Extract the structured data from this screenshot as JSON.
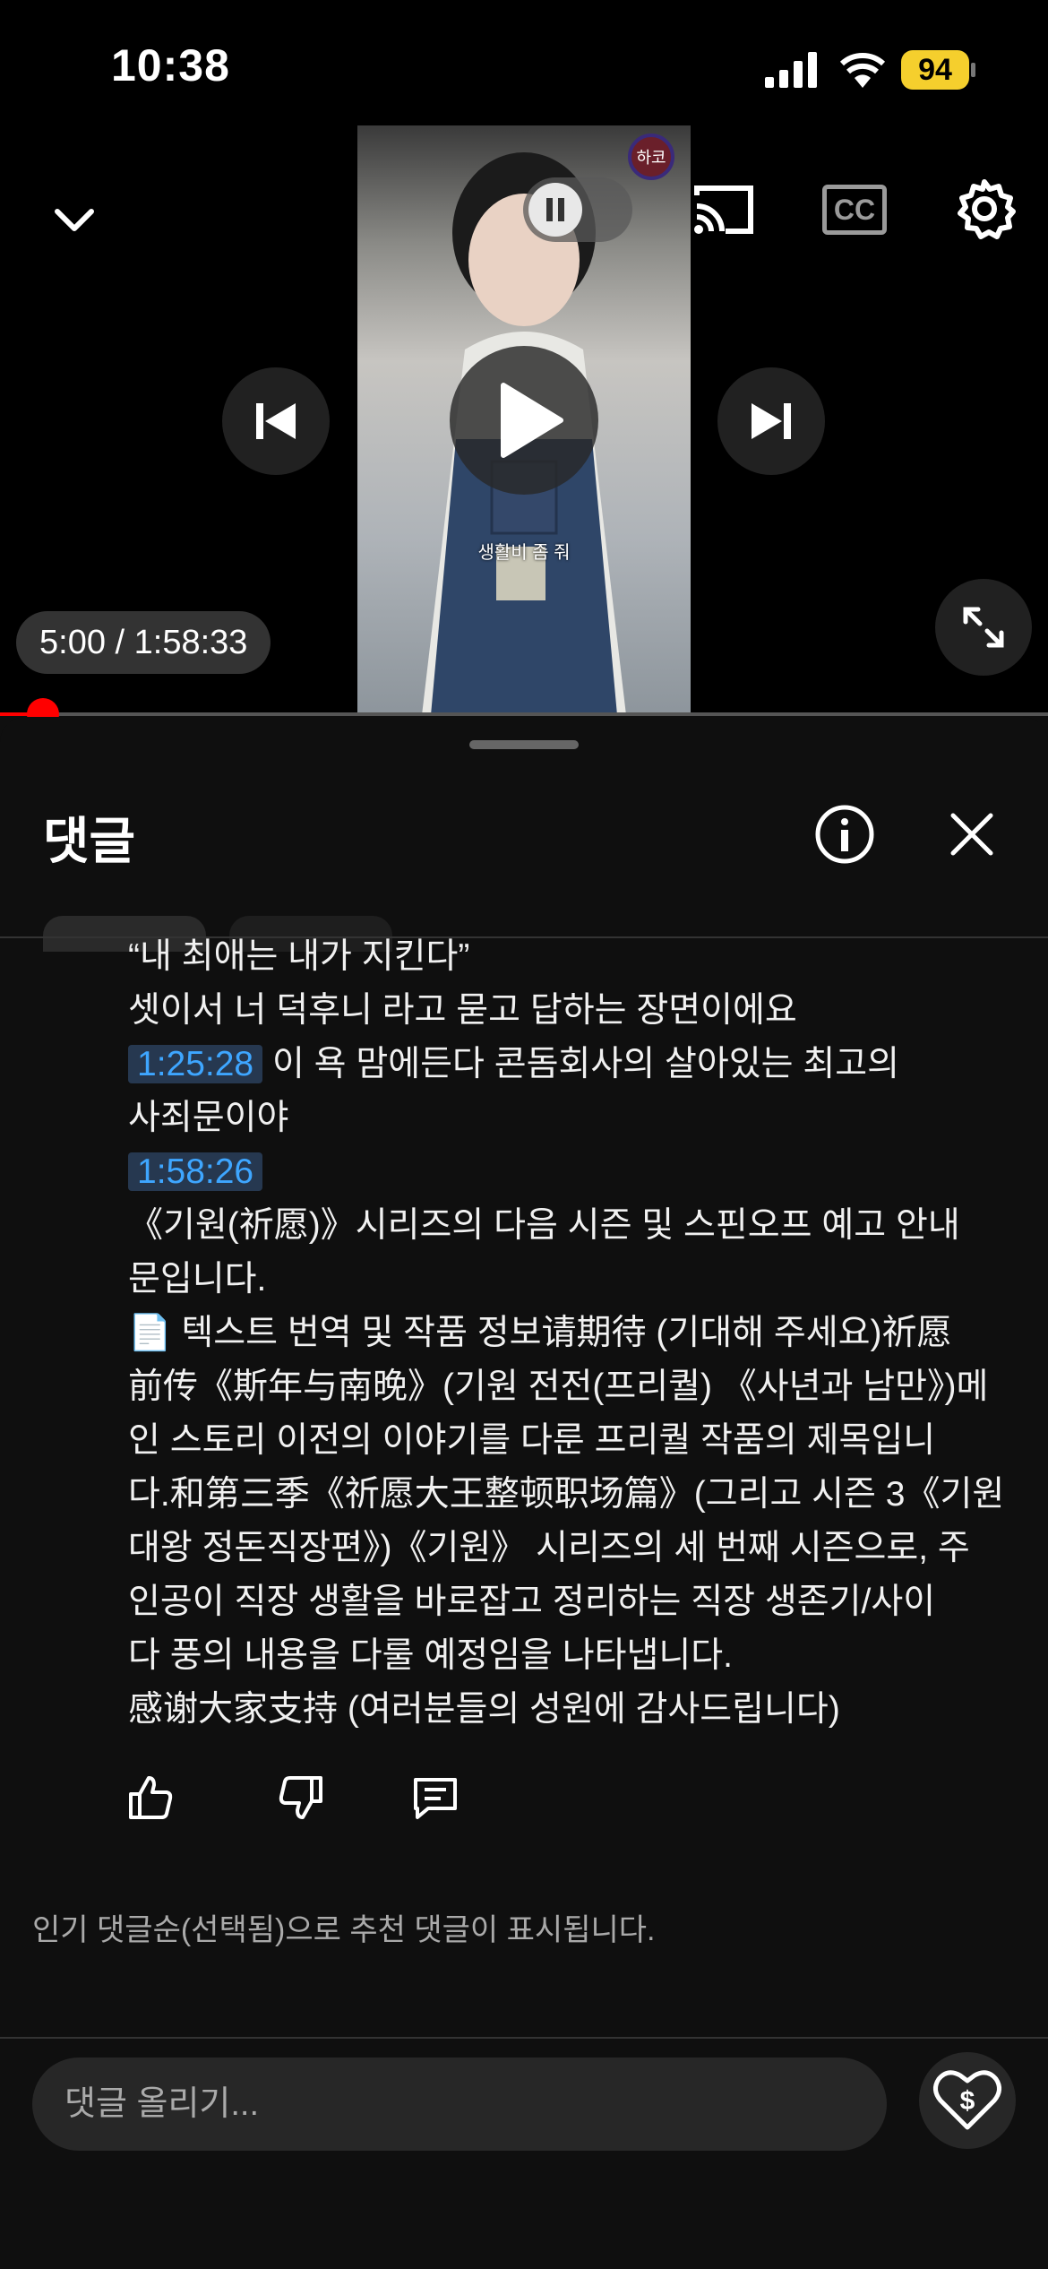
{
  "status_bar": {
    "time": "10:38",
    "battery": "94"
  },
  "video": {
    "time_display": "5:00 / 1:58:33",
    "overlay_caption": "생활비 좀 줘",
    "channel_mark": "하코",
    "progress_fraction": 0.0042
  },
  "sheet": {
    "title": "댓글"
  },
  "comment": {
    "lines": [
      {
        "text": "“내 최애는 내가 지킨다”"
      },
      {
        "text": "셋이서 너 덕후니 라고 묻고 답하는 장면이에요"
      },
      {
        "timestamp": "1:25:28",
        "text": " 이 욕 맘에든다 콘돔회사의 살아있는 최고의"
      },
      {
        "text": "사죄문이야"
      },
      {
        "timestamp": "1:58:26",
        "text": ""
      },
      {
        "text": "《기원(祈愿)》시리즈의 다음 시즌 및 스핀오프 예고 안내"
      },
      {
        "text": "문입니다."
      },
      {
        "emoji": "📄",
        "text": " 텍스트 번역 및 작품 정보请期待 (기대해 주세요)祈愿"
      },
      {
        "text": "前传《斯年与南晚》(기원 전전(프리퀄) 《사년과 남만》)메"
      },
      {
        "text": "인 스토리 이전의 이야기를 다룬 프리퀄 작품의 제목입니"
      },
      {
        "text": "다.和第三季《祈愿大王整顿职场篇》(그리고 시즌 3《기원"
      },
      {
        "text": "대왕 정돈직장편》)《기원》 시리즈의 세 번째 시즌으로, 주"
      },
      {
        "text": "인공이 직장 생활을 바로잡고 정리하는 직장 생존기/사이"
      },
      {
        "text": "다 풍의 내용을 다룰 예정임을 나타냅니다."
      },
      {
        "text": "感谢大家支持 (여러분들의 성원에 감사드립니다)"
      }
    ]
  },
  "footer_note": "인기 댓글순(선택됨)으로 추천 댓글이 표시됩니다.",
  "input": {
    "placeholder": "댓글 올리기..."
  },
  "icons": {
    "collapse": "chevron-down-icon",
    "pause": "pause-icon",
    "cast": "cast-icon",
    "captions": "cc-icon",
    "settings": "gear-icon",
    "previous": "skip-previous-icon",
    "play": "play-icon",
    "next": "skip-next-icon",
    "fullscreen": "fullscreen-icon",
    "info": "info-icon",
    "close": "close-icon",
    "like": "thumbs-up-icon",
    "dislike": "thumbs-down-icon",
    "reply": "reply-icon",
    "thanks": "super-thanks-icon"
  },
  "colors": {
    "accent_red": "#ff0000",
    "timestamp_blue": "#3ea6ff",
    "battery_yellow": "#f5cf2d"
  }
}
